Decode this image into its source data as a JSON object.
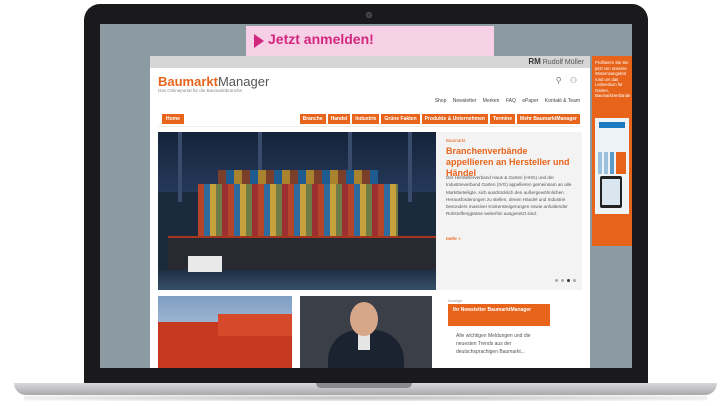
{
  "banner": {
    "text": "Jetzt anmelden!"
  },
  "site": {
    "rm_badge": "RM",
    "rm_name": "Rudolf Müller",
    "logo_part1": "Baumarkt",
    "logo_part2": "Manager",
    "tagline": "Das Onlineportal für die Baumarktbranche",
    "header_icons": "⚲ ⚇",
    "top_nav": [
      "Shop",
      "Newsletter",
      "Merken",
      "FAQ",
      "ePaper",
      "Kontakt & Team"
    ],
    "nav_home": "Home",
    "nav_items": [
      "Branche",
      "Handel",
      "Industrie",
      "Grüne Fakten",
      "Produkte & Unternehmen",
      "Termine",
      "Mehr BaumarktManager"
    ]
  },
  "hero": {
    "kicker": "Baumarkt",
    "headline": "Branchenverbände appellieren an Hersteller und Händel",
    "body": "Der Herstellerverband Haus & Garten (HHG) und der Industrieverband Garten (IVG) appellieren gemeinsam an alle Marktbeteiligte, sich ausdrücklich den außergewöhnlichen Herausforderungen zu stellen, denen Händel und Industrie besonders massiver Kostensteigerungen sowie anhaltender Rohstoffengpässe weiterhin ausgesetzt sind.",
    "more": "mehr »"
  },
  "newsletter": {
    "label": "Anzeige",
    "title": "Ihr Newsletter BaumarktManager",
    "body": "Alle wichtigen Meldungen und die neuesten Trends aus der deutschsprachigen Baumarkt..."
  },
  "sidebar_ad": {
    "text": "Profitieren Sie Sie jetzt von unseren Wissensangebot rund um das Leitmedium für Garten, Baumarktverbände"
  },
  "colors": {
    "accent": "#e8641b",
    "banner_pink": "#d3277f"
  }
}
